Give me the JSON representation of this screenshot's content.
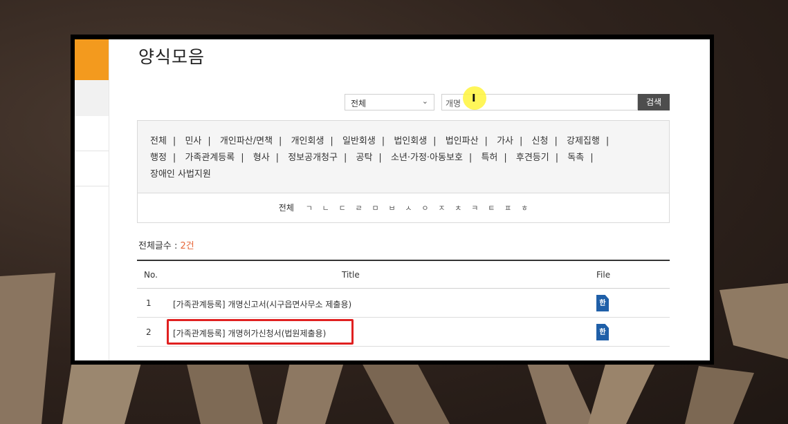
{
  "page": {
    "title": "양식모음"
  },
  "search": {
    "select_value": "전체",
    "input_value": "개명",
    "button_label": "검색"
  },
  "categories": [
    "전체",
    "민사",
    "개인파산/면책",
    "개인회생",
    "일반회생",
    "법인회생",
    "법인파산",
    "가사",
    "신청",
    "강제집행",
    "행정",
    "가족관계등록",
    "형사",
    "정보공개청구",
    "공탁",
    "소년·가정·아동보호",
    "특허",
    "후견등기",
    "독촉",
    "장애인 사법지원"
  ],
  "consonants": {
    "all_label": "전체",
    "items": [
      "ㄱ",
      "ㄴ",
      "ㄷ",
      "ㄹ",
      "ㅁ",
      "ㅂ",
      "ㅅ",
      "ㅇ",
      "ㅈ",
      "ㅊ",
      "ㅋ",
      "ㅌ",
      "ㅍ",
      "ㅎ"
    ]
  },
  "count": {
    "label": "전체글수 : ",
    "value": "2건"
  },
  "table": {
    "headers": {
      "no": "No.",
      "title": "Title",
      "file": "File"
    },
    "rows": [
      {
        "no": "1",
        "title": "[가족관계등록] 개명신고서(시구읍면사무소 제출용)",
        "file_icon": "hwp-file-icon"
      },
      {
        "no": "2",
        "title": "[가족관계등록] 개명허가신청서(법원제출용)",
        "file_icon": "hwp-file-icon"
      }
    ]
  },
  "colors": {
    "accent": "#f39a1e",
    "highlight": "#e02020",
    "count": "#e7673a",
    "file_icon": "#1f5fa8"
  }
}
